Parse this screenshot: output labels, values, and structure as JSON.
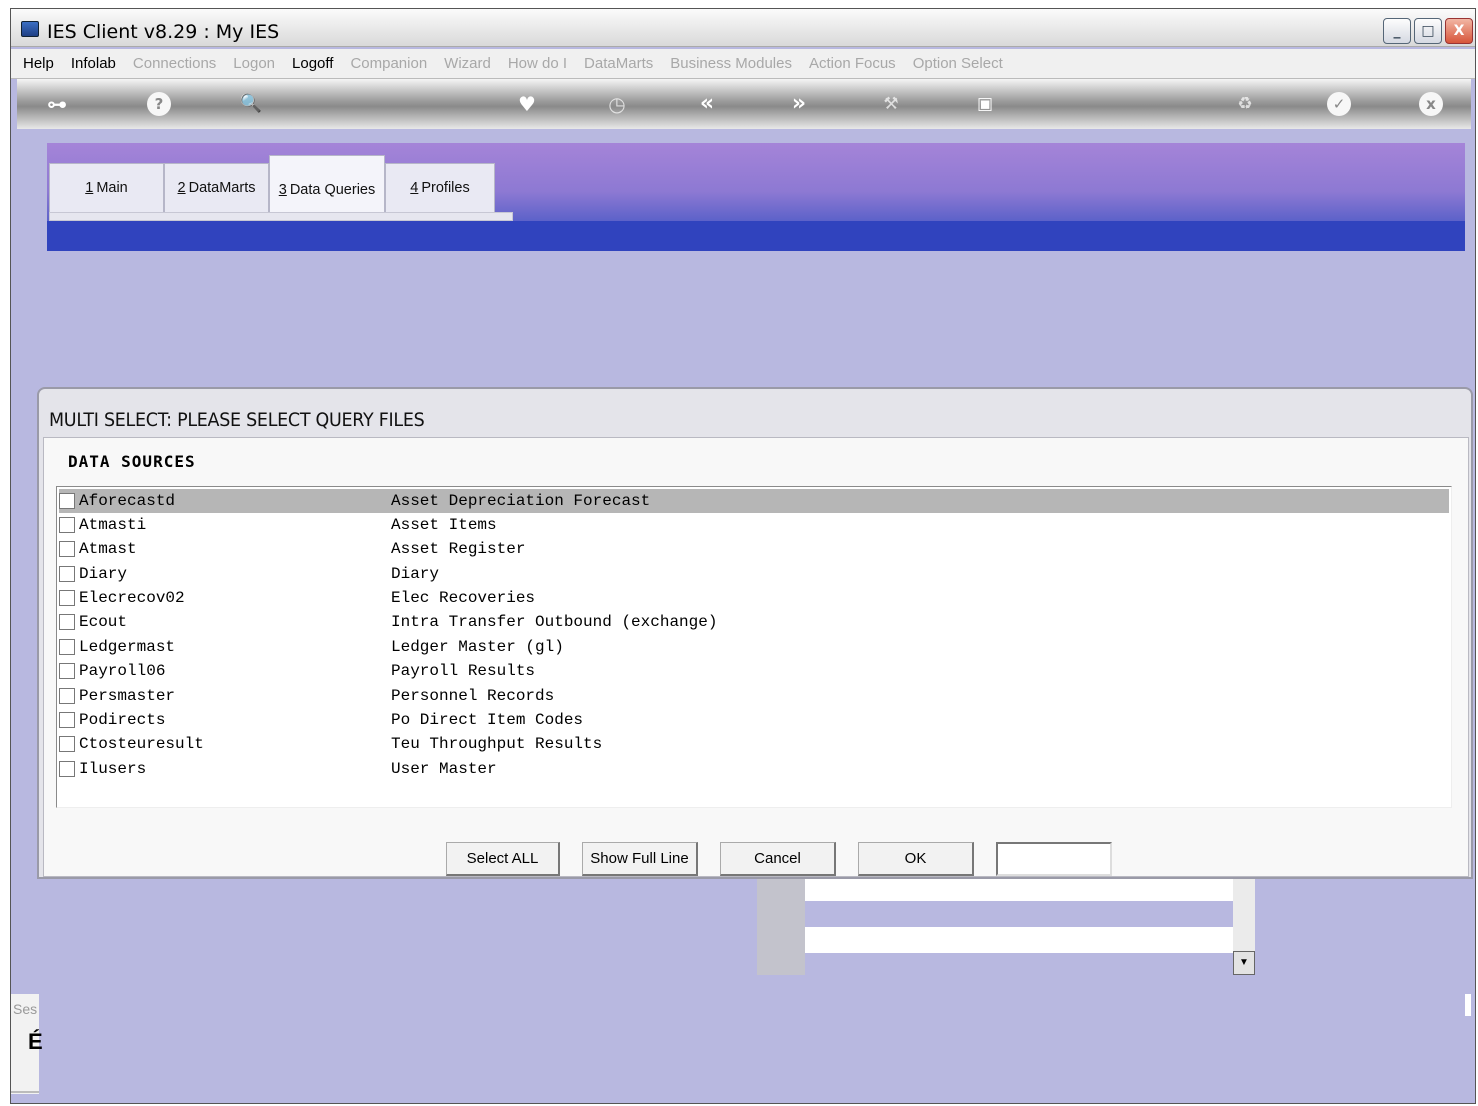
{
  "window": {
    "title": "IES Client v8.29 : My IES",
    "controls": {
      "minimize": "_",
      "maximize": "□",
      "close": "X"
    }
  },
  "menu": [
    {
      "label": "Help",
      "enabled": true
    },
    {
      "label": "Infolab",
      "enabled": true
    },
    {
      "label": "Connections",
      "enabled": false
    },
    {
      "label": "Logon",
      "enabled": false
    },
    {
      "label": "Logoff",
      "enabled": true
    },
    {
      "label": "Companion",
      "enabled": false
    },
    {
      "label": "Wizard",
      "enabled": false
    },
    {
      "label": "How do I",
      "enabled": false
    },
    {
      "label": "DataMarts",
      "enabled": false
    },
    {
      "label": "Business Modules",
      "enabled": false
    },
    {
      "label": "Action Focus",
      "enabled": false
    },
    {
      "label": "Option Select",
      "enabled": false
    }
  ],
  "toolbar": {
    "icons": [
      "key-icon",
      "help-icon",
      "search-icon",
      "heart-icon",
      "clock-icon",
      "back-icon",
      "forward-icon",
      "tools-icon",
      "chip-icon",
      "recycle-icon",
      "check-icon",
      "close-icon"
    ],
    "glyphs": {
      "key": "⊶",
      "help": "?",
      "search": "🔍",
      "heart": "♥",
      "clock": "◷",
      "back": "«",
      "forward": "»",
      "tools": "⚒",
      "chip": "▣",
      "recycle": "♻",
      "check": "✓",
      "close": "x"
    }
  },
  "tabs": [
    {
      "num": "1",
      "label": "Main"
    },
    {
      "num": "2",
      "label": "DataMarts"
    },
    {
      "num": "3",
      "label": "Data Queries",
      "active": true
    },
    {
      "num": "4",
      "label": "Profiles"
    }
  ],
  "dialog": {
    "title": "MULTI SELECT: PLEASE SELECT QUERY FILES",
    "section": "DATA SOURCES",
    "rows": [
      {
        "code": "Aforecastd",
        "desc": "Asset Depreciation Forecast",
        "selected": true
      },
      {
        "code": "Atmasti",
        "desc": "Asset Items"
      },
      {
        "code": "Atmast",
        "desc": "Asset Register"
      },
      {
        "code": "Diary",
        "desc": "Diary"
      },
      {
        "code": "Elecrecov02",
        "desc": "Elec Recoveries"
      },
      {
        "code": "Ecout",
        "desc": "Intra Transfer Outbound (exchange)"
      },
      {
        "code": "Ledgermast",
        "desc": "Ledger Master (gl)"
      },
      {
        "code": "Payroll06",
        "desc": "Payroll Results"
      },
      {
        "code": "Persmaster",
        "desc": "Personnel Records"
      },
      {
        "code": "Podirects",
        "desc": "Po Direct Item Codes"
      },
      {
        "code": "Ctosteuresult",
        "desc": "Teu Throughput Results"
      },
      {
        "code": "Ilusers",
        "desc": "User Master"
      }
    ],
    "buttons": {
      "select_all": "Select ALL",
      "show_full_line": "Show Full Line",
      "cancel": "Cancel",
      "ok": "OK"
    },
    "input_value": ""
  },
  "status": {
    "label": "Ses",
    "glyph": "É"
  },
  "colors": {
    "background": "#b8b8e0",
    "band_top": "#a584d8",
    "band_bottom": "#3043be",
    "selected_row": "#b6b6b6"
  }
}
